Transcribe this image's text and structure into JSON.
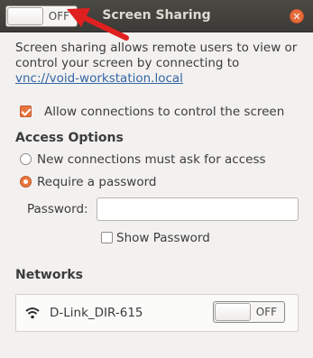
{
  "window": {
    "title": "Screen Sharing",
    "toggle_state": "OFF",
    "close_icon": "close-icon"
  },
  "description": {
    "text": "Screen sharing allows remote users to view or control your screen by connecting to ",
    "link": "vnc://void-workstation.local"
  },
  "allow_control": {
    "label": "Allow connections to control the screen",
    "checked": true
  },
  "access_options": {
    "title": "Access Options",
    "options": [
      {
        "label": "New connections must ask for access",
        "selected": false
      },
      {
        "label": "Require a password",
        "selected": true
      }
    ],
    "password_label": "Password:",
    "password_value": "",
    "show_password_label": "Show Password",
    "show_password_checked": false
  },
  "networks": {
    "title": "Networks",
    "items": [
      {
        "name": "D-Link_DIR-615",
        "icon": "wifi-icon",
        "toggle_state": "OFF"
      }
    ]
  },
  "colors": {
    "titlebar": "#3c3b37",
    "accent": "#e9753f",
    "link": "#3465a4",
    "annotation_arrow": "#e0201f"
  }
}
